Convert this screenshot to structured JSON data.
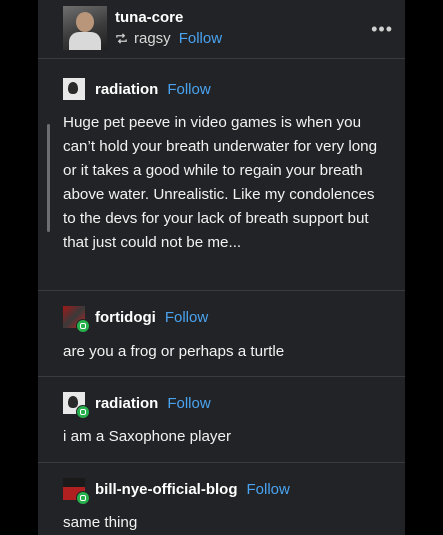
{
  "post": {
    "author": "tuna-core",
    "reblog_source": "ragsy",
    "follow_label": "Follow",
    "more_icon": "ellipsis-icon"
  },
  "thread": [
    {
      "author": "radiation",
      "follow_label": "Follow",
      "text": "Huge pet peeve in video games is when you can’t hold your breath underwater for very long or it takes a good while to regain your breath above water. Unrealistic. Like my condolences to the devs for your lack of breath support but that just could not be me..."
    },
    {
      "author": "fortidogi",
      "follow_label": "Follow",
      "text": "are you a frog or perhaps a turtle"
    },
    {
      "author": "radiation",
      "follow_label": "Follow",
      "text": "i am a Saxophone player"
    },
    {
      "author": "bill-nye-official-blog",
      "follow_label": "Follow",
      "text": "same thing"
    }
  ],
  "colors": {
    "background": "#222326",
    "link": "#4aa3f0",
    "badge": "#27b04d"
  }
}
